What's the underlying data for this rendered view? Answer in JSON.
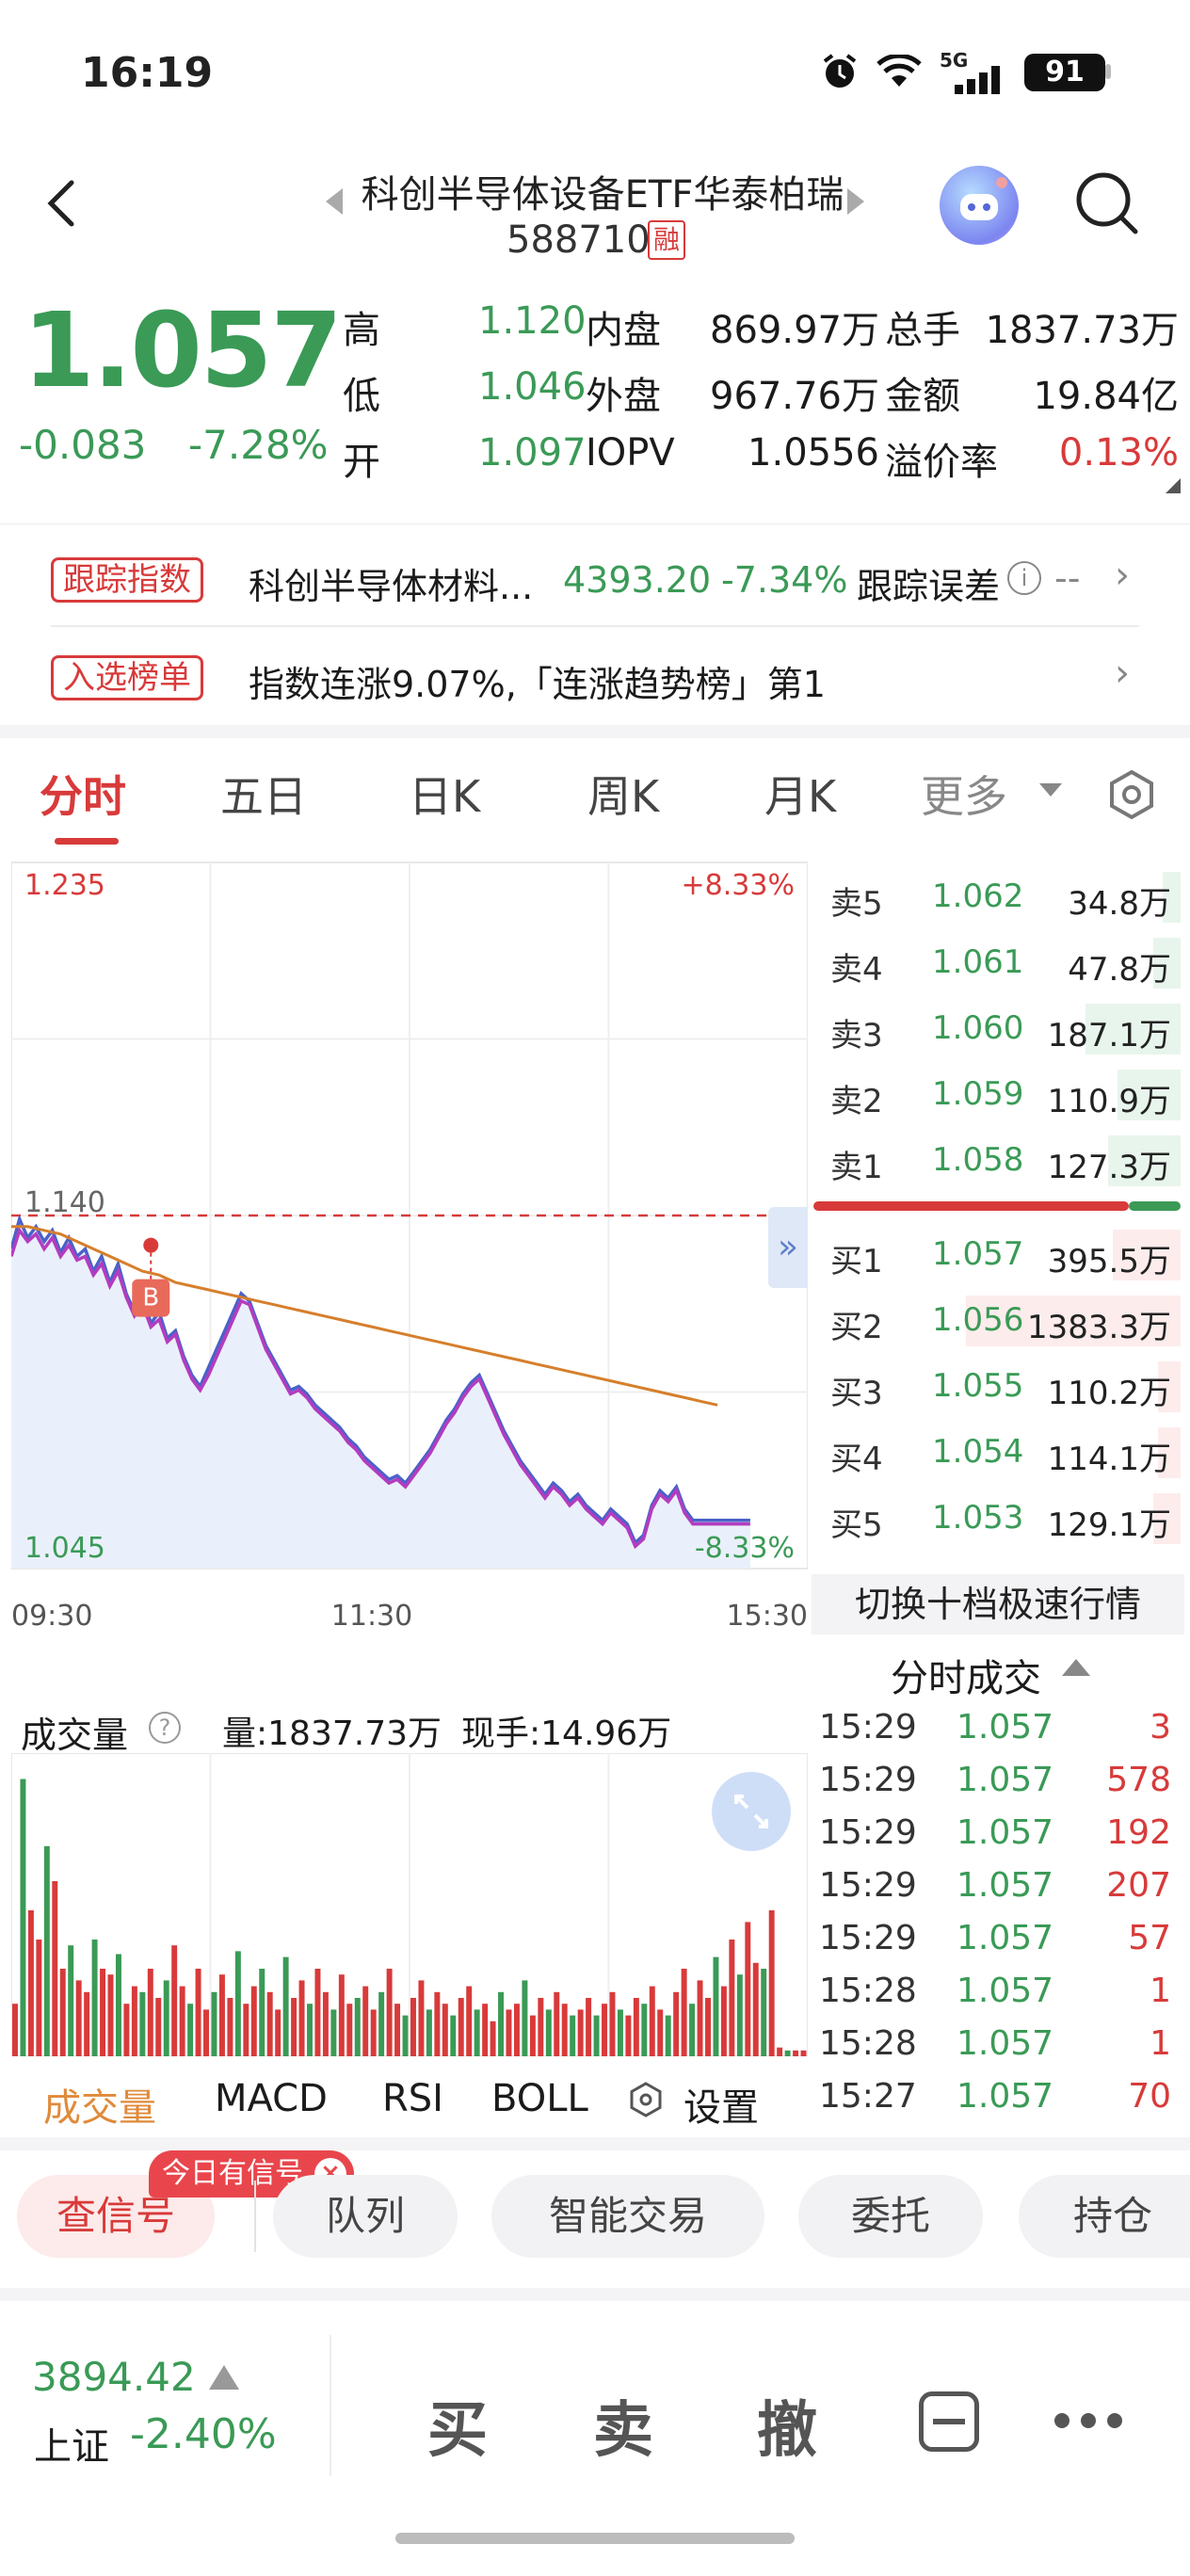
{
  "status_bar": {
    "time": "16:19",
    "network": "5G",
    "battery": "91"
  },
  "header": {
    "title": "科创半导体设备ETF华泰柏瑞",
    "code": "588710",
    "margin_badge": "融"
  },
  "quote": {
    "price": "1.057",
    "change": "-0.083",
    "change_pct": "-7.28%",
    "stats": [
      [
        {
          "label": "高",
          "value": "1.120",
          "color": "green"
        },
        {
          "label": "内盘",
          "value": "869.97万",
          "color": "dark"
        },
        {
          "label": "总手",
          "value": "1837.73万",
          "color": "dark"
        }
      ],
      [
        {
          "label": "低",
          "value": "1.046",
          "color": "green"
        },
        {
          "label": "外盘",
          "value": "967.76万",
          "color": "dark"
        },
        {
          "label": "金额",
          "value": "19.84亿",
          "color": "dark"
        }
      ],
      [
        {
          "label": "开",
          "value": "1.097",
          "color": "green"
        },
        {
          "label": "IOPV",
          "value": "1.0556",
          "color": "dark"
        },
        {
          "label": "溢价率",
          "value": "0.13%",
          "color": "red"
        }
      ]
    ]
  },
  "tracking": {
    "tag": "跟踪指数",
    "name": "科创半导体材料...",
    "value": "4393.20",
    "pct": "-7.34%",
    "error_label": "跟踪误差",
    "error_value": "--"
  },
  "ranking": {
    "tag": "入选榜单",
    "text": "指数连涨9.07%,「连涨趋势榜」第1"
  },
  "tabs": [
    "分时",
    "五日",
    "日K",
    "周K",
    "月K",
    "更多"
  ],
  "chart_data": {
    "type": "line",
    "title": "",
    "ylim": [
      1.045,
      1.235
    ],
    "y_labels": {
      "top": "1.235",
      "mid": "1.140",
      "bottom": "1.045"
    },
    "pct_labels": {
      "top": "+8.33%",
      "bottom": "-8.33%"
    },
    "x_labels": [
      "09:30",
      "11:30",
      "15:30"
    ],
    "prev_close": 1.14,
    "signal": {
      "label": "B",
      "x": 0.17,
      "y": 1.132
    },
    "series": [
      {
        "values": [
          1.131,
          1.139,
          1.134,
          1.137,
          1.133,
          1.136,
          1.13,
          1.134,
          1.129,
          1.131,
          1.125,
          1.129,
          1.122,
          1.127,
          1.119,
          1.114,
          1.118,
          1.111,
          1.114,
          1.107,
          1.109,
          1.102,
          1.097,
          1.094,
          1.099,
          1.104,
          1.109,
          1.114,
          1.119,
          1.117,
          1.111,
          1.105,
          1.101,
          1.097,
          1.093,
          1.094,
          1.092,
          1.089,
          1.087,
          1.085,
          1.083,
          1.08,
          1.078,
          1.075,
          1.073,
          1.071,
          1.069,
          1.07,
          1.068,
          1.071,
          1.074,
          1.077,
          1.081,
          1.085,
          1.088,
          1.092,
          1.095,
          1.097,
          1.092,
          1.087,
          1.082,
          1.078,
          1.074,
          1.071,
          1.068,
          1.065,
          1.068,
          1.066,
          1.063,
          1.065,
          1.062,
          1.06,
          1.058,
          1.061,
          1.059,
          1.057,
          1.052,
          1.054,
          1.062,
          1.066,
          1.064,
          1.067,
          1.061,
          1.058,
          1.058,
          1.058,
          1.058,
          1.058,
          1.058,
          1.058,
          1.058
        ],
        "x": [
          0,
          0.01,
          0.02,
          0.03,
          0.04,
          0.05,
          0.06,
          0.07,
          0.08,
          0.09,
          0.1,
          0.11,
          0.12,
          0.13,
          0.14,
          0.15,
          0.16,
          0.17,
          0.18,
          0.19,
          0.2,
          0.21,
          0.22,
          0.23,
          0.24,
          0.25,
          0.26,
          0.27,
          0.28,
          0.29,
          0.3,
          0.31,
          0.32,
          0.33,
          0.34,
          0.35,
          0.36,
          0.37,
          0.38,
          0.39,
          0.4,
          0.41,
          0.42,
          0.43,
          0.44,
          0.45,
          0.46,
          0.47,
          0.48,
          0.49,
          0.5,
          0.51,
          0.52,
          0.53,
          0.54,
          0.55,
          0.56,
          0.57,
          0.58,
          0.59,
          0.6,
          0.61,
          0.62,
          0.63,
          0.64,
          0.65,
          0.66,
          0.67,
          0.68,
          0.69,
          0.7,
          0.71,
          0.72,
          0.73,
          0.74,
          0.75,
          0.76,
          0.77,
          0.78,
          0.79,
          0.8,
          0.81,
          0.82,
          0.83,
          0.84,
          0.85,
          0.86,
          0.87,
          0.88,
          0.89,
          0.9
        ],
        "color": "#4a62c8"
      },
      {
        "values": [
          1.129,
          1.136,
          1.133,
          1.135,
          1.131,
          1.134,
          1.129,
          1.132,
          1.128,
          1.129,
          1.124,
          1.127,
          1.121,
          1.125,
          1.118,
          1.113,
          1.116,
          1.11,
          1.112,
          1.106,
          1.108,
          1.101,
          1.096,
          1.093,
          1.097,
          1.102,
          1.107,
          1.112,
          1.117,
          1.116,
          1.11,
          1.104,
          1.1,
          1.096,
          1.092,
          1.093,
          1.091,
          1.088,
          1.086,
          1.084,
          1.082,
          1.079,
          1.077,
          1.074,
          1.072,
          1.07,
          1.068,
          1.069,
          1.067,
          1.07,
          1.073,
          1.076,
          1.08,
          1.084,
          1.087,
          1.091,
          1.094,
          1.096,
          1.091,
          1.086,
          1.081,
          1.077,
          1.073,
          1.07,
          1.067,
          1.064,
          1.067,
          1.065,
          1.062,
          1.064,
          1.061,
          1.059,
          1.057,
          1.06,
          1.058,
          1.056,
          1.051,
          1.053,
          1.061,
          1.065,
          1.063,
          1.066,
          1.06,
          1.057,
          1.057,
          1.057,
          1.057,
          1.057,
          1.057,
          1.057,
          1.057
        ],
        "x": [
          0,
          0.01,
          0.02,
          0.03,
          0.04,
          0.05,
          0.06,
          0.07,
          0.08,
          0.09,
          0.1,
          0.11,
          0.12,
          0.13,
          0.14,
          0.15,
          0.16,
          0.17,
          0.18,
          0.19,
          0.2,
          0.21,
          0.22,
          0.23,
          0.24,
          0.25,
          0.26,
          0.27,
          0.28,
          0.29,
          0.3,
          0.31,
          0.32,
          0.33,
          0.34,
          0.35,
          0.36,
          0.37,
          0.38,
          0.39,
          0.4,
          0.41,
          0.42,
          0.43,
          0.44,
          0.45,
          0.46,
          0.47,
          0.48,
          0.49,
          0.5,
          0.51,
          0.52,
          0.53,
          0.54,
          0.55,
          0.56,
          0.57,
          0.58,
          0.59,
          0.6,
          0.61,
          0.62,
          0.63,
          0.64,
          0.65,
          0.66,
          0.67,
          0.68,
          0.69,
          0.7,
          0.71,
          0.72,
          0.73,
          0.74,
          0.75,
          0.76,
          0.77,
          0.78,
          0.79,
          0.8,
          0.81,
          0.82,
          0.83,
          0.84,
          0.85,
          0.86,
          0.87,
          0.88,
          0.89,
          0.9
        ],
        "color": "#b43cc0"
      },
      {
        "values": [
          1.137,
          1.137,
          1.136,
          1.135,
          1.133,
          1.131,
          1.129,
          1.127,
          1.125,
          1.124,
          1.122,
          1.121,
          1.12,
          1.119,
          1.118,
          1.117,
          1.116,
          1.115,
          1.114,
          1.113,
          1.112,
          1.111,
          1.11,
          1.109,
          1.108,
          1.107,
          1.106,
          1.105,
          1.104,
          1.103,
          1.102,
          1.101,
          1.1,
          1.099,
          1.098,
          1.097,
          1.096,
          1.095,
          1.094,
          1.093,
          1.092,
          1.091,
          1.09,
          1.089
        ],
        "x": [
          0,
          0.02,
          0.04,
          0.06,
          0.08,
          0.1,
          0.12,
          0.14,
          0.16,
          0.18,
          0.2,
          0.22,
          0.24,
          0.26,
          0.28,
          0.3,
          0.32,
          0.34,
          0.36,
          0.38,
          0.4,
          0.42,
          0.44,
          0.46,
          0.48,
          0.5,
          0.52,
          0.54,
          0.56,
          0.58,
          0.6,
          0.62,
          0.64,
          0.66,
          0.68,
          0.7,
          0.72,
          0.74,
          0.76,
          0.78,
          0.8,
          0.82,
          0.84,
          0.86
        ],
        "color": "#d67f2c"
      }
    ]
  },
  "volume": {
    "title": "成交量",
    "total": "量:1837.73万",
    "current": "现手:14.96万",
    "bars": [
      18,
      95,
      50,
      40,
      72,
      60,
      30,
      38,
      26,
      22,
      40,
      30,
      28,
      35,
      18,
      24,
      22,
      30,
      20,
      26,
      38,
      24,
      18,
      30,
      16,
      22,
      28,
      20,
      36,
      18,
      24,
      30,
      22,
      16,
      34,
      20,
      26,
      18,
      30,
      22,
      16,
      28,
      18,
      20,
      24,
      16,
      22,
      30,
      18,
      14,
      20,
      26,
      16,
      22,
      18,
      14,
      20,
      24,
      16,
      18,
      12,
      22,
      16,
      18,
      26,
      14,
      20,
      16,
      22,
      18,
      14,
      16,
      20,
      14,
      18,
      22,
      16,
      14,
      20,
      18,
      24,
      16,
      14,
      22,
      30,
      18,
      26,
      20,
      34,
      24,
      40,
      28,
      46,
      32,
      30,
      50,
      3,
      2,
      2,
      2
    ]
  },
  "indicator_tabs": [
    "成交量",
    "MACD",
    "RSI",
    "BOLL",
    "设置"
  ],
  "order_book": {
    "asks": [
      {
        "label": "卖5",
        "price": "1.062",
        "vol": "34.8万",
        "w": 0.08
      },
      {
        "label": "卖4",
        "price": "1.061",
        "vol": "47.8万",
        "w": 0.12
      },
      {
        "label": "卖3",
        "price": "1.060",
        "vol": "187.1万",
        "w": 0.42
      },
      {
        "label": "卖2",
        "price": "1.059",
        "vol": "110.9万",
        "w": 0.28
      },
      {
        "label": "卖1",
        "price": "1.058",
        "vol": "127.3万",
        "w": 0.32
      }
    ],
    "bids": [
      {
        "label": "买1",
        "price": "1.057",
        "vol": "395.5万",
        "w": 0.3
      },
      {
        "label": "买2",
        "price": "1.056",
        "vol": "1383.3万",
        "w": 0.95
      },
      {
        "label": "买3",
        "price": "1.055",
        "vol": "110.2万",
        "w": 0.1
      },
      {
        "label": "买4",
        "price": "1.054",
        "vol": "114.1万",
        "w": 0.1
      },
      {
        "label": "买5",
        "price": "1.053",
        "vol": "129.1万",
        "w": 0.12
      }
    ],
    "buy_ratio": 0.86,
    "switch_label": "切换十档极速行情"
  },
  "trades": {
    "title": "分时成交",
    "rows": [
      {
        "t": "15:29",
        "p": "1.057",
        "v": "3"
      },
      {
        "t": "15:29",
        "p": "1.057",
        "v": "578"
      },
      {
        "t": "15:29",
        "p": "1.057",
        "v": "192"
      },
      {
        "t": "15:29",
        "p": "1.057",
        "v": "207"
      },
      {
        "t": "15:29",
        "p": "1.057",
        "v": "57"
      },
      {
        "t": "15:28",
        "p": "1.057",
        "v": "1"
      },
      {
        "t": "15:28",
        "p": "1.057",
        "v": "1"
      },
      {
        "t": "15:27",
        "p": "1.057",
        "v": "70"
      }
    ]
  },
  "actions": {
    "signal_badge": "今日有信号",
    "items": [
      "查信号",
      "队列",
      "智能交易",
      "委托",
      "持仓"
    ]
  },
  "bottom": {
    "index_value": "3894.42",
    "index_name": "上证",
    "index_pct": "-2.40%",
    "buy": "买",
    "sell": "卖",
    "cancel": "撤"
  },
  "colors": {
    "up": "#d83a3a",
    "down": "#3a9a56",
    "accent": "#d83a3a"
  }
}
